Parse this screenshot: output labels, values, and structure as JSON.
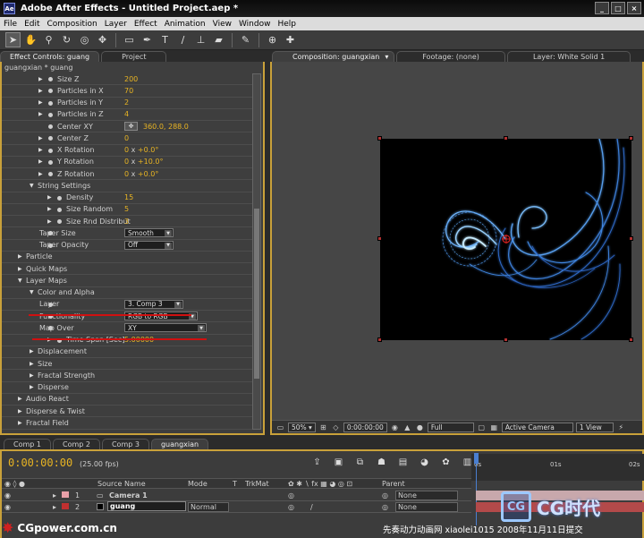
{
  "window": {
    "title": "Adobe After Effects - Untitled Project.aep *"
  },
  "menu": [
    "File",
    "Edit",
    "Composition",
    "Layer",
    "Effect",
    "Animation",
    "View",
    "Window",
    "Help"
  ],
  "toolbar": {
    "tools": [
      "selection-tool",
      "hand-tool",
      "zoom-tool",
      "rotation-tool",
      "orbit-camera-tool",
      "track-xy-camera-tool",
      "rectangle-mask-tool",
      "pen-tool",
      "type-tool",
      "brush-tool",
      "clone-stamp-tool",
      "eraser-tool",
      "puppet-pin-tool"
    ]
  },
  "panels": {
    "left_tabs": [
      "Effect Controls: guang",
      "Project"
    ],
    "right_tabs": [
      "Composition: guangxian",
      "Footage: (none)",
      "Layer: White Solid 1"
    ]
  },
  "effect_controls": {
    "subtitle": "guangxian * guang",
    "rows": [
      {
        "label": "Size Z",
        "value": "200",
        "indent": 2,
        "kind": "value"
      },
      {
        "label": "Particles in X",
        "value": "70",
        "indent": 2,
        "kind": "value"
      },
      {
        "label": "Particles in Y",
        "value": "2",
        "indent": 2,
        "kind": "value"
      },
      {
        "label": "Particles in Z",
        "value": "4",
        "indent": 2,
        "kind": "value"
      },
      {
        "label": "Center XY",
        "value": "360.0, 288.0",
        "indent": 2,
        "kind": "point"
      },
      {
        "label": "Center Z",
        "value": "0",
        "indent": 2,
        "kind": "value"
      },
      {
        "label": "X Rotation",
        "value_a": "0",
        "value_b": "+0.0°",
        "indent": 2,
        "kind": "angle"
      },
      {
        "label": "Y Rotation",
        "value_a": "0",
        "value_b": "+10.0°",
        "indent": 2,
        "kind": "angle"
      },
      {
        "label": "Z Rotation",
        "value_a": "0",
        "value_b": "+0.0°",
        "indent": 2,
        "kind": "angle"
      },
      {
        "label": "String Settings",
        "indent": 1,
        "kind": "group-open"
      },
      {
        "label": "Density",
        "value": "15",
        "indent": 3,
        "kind": "value"
      },
      {
        "label": "Size Random",
        "value": "5",
        "indent": 3,
        "kind": "value"
      },
      {
        "label": "Size Rnd Distribut",
        "value": "3",
        "indent": 3,
        "kind": "value"
      },
      {
        "label": "Taper Size",
        "value": "Smooth",
        "indent": 2,
        "kind": "dropdown"
      },
      {
        "label": "Taper Opacity",
        "value": "Off",
        "indent": 2,
        "kind": "dropdown"
      },
      {
        "label": "Particle",
        "indent": 0,
        "kind": "group"
      },
      {
        "label": "Quick Maps",
        "indent": 0,
        "kind": "group"
      },
      {
        "label": "Layer Maps",
        "indent": 0,
        "kind": "group-open"
      },
      {
        "label": "Color and Alpha",
        "indent": 1,
        "kind": "group-open"
      },
      {
        "label": "Layer",
        "value": "3. Comp 3",
        "indent": 2,
        "kind": "dropdown"
      },
      {
        "label": "Functionality",
        "value": "RGB to RGB",
        "indent": 2,
        "kind": "dropdown"
      },
      {
        "label": "Map Over",
        "value": "XY",
        "indent": 2,
        "kind": "dropdown"
      },
      {
        "label": "Time Span [Sec]",
        "value": "5.00000",
        "indent": 3,
        "kind": "value"
      },
      {
        "label": "Displacement",
        "indent": 1,
        "kind": "group"
      },
      {
        "label": "Size",
        "indent": 1,
        "kind": "group"
      },
      {
        "label": "Fractal Strength",
        "indent": 1,
        "kind": "group"
      },
      {
        "label": "Disperse",
        "indent": 1,
        "kind": "group"
      },
      {
        "label": "Audio React",
        "indent": 0,
        "kind": "group"
      },
      {
        "label": "Disperse & Twist",
        "indent": 0,
        "kind": "group"
      },
      {
        "label": "Fractal Field",
        "indent": 0,
        "kind": "group"
      }
    ]
  },
  "viewer": {
    "zoom": "50%",
    "timecode": "0:00:00:00",
    "resolution": "Full",
    "camera": "Active Camera",
    "views": "1 View"
  },
  "timeline": {
    "tabs": [
      "Comp 1",
      "Comp 2",
      "Comp 3",
      "guangxian"
    ],
    "timecode": "0:00:00:00",
    "fps": "(25.00 fps)",
    "ruler": [
      "0s",
      "01s",
      "02s"
    ],
    "columns": {
      "source": "Source Name",
      "mode": "Mode",
      "t": "T",
      "trkmat": "TrkMat",
      "parent": "Parent"
    },
    "layers": [
      {
        "num": "1",
        "name": "Camera 1",
        "mode": "",
        "parent": "None",
        "color": "#e8a0a8"
      },
      {
        "num": "2",
        "name": "guang",
        "mode": "Normal",
        "parent": "None",
        "color": "#c03030"
      }
    ]
  },
  "watermark": {
    "left": "CGpower.com.cn",
    "right": "先奏动力动画网 xiaolei1015 2008年11月11日提交",
    "logo_badge": "CG",
    "logo_text": "CG时代"
  }
}
